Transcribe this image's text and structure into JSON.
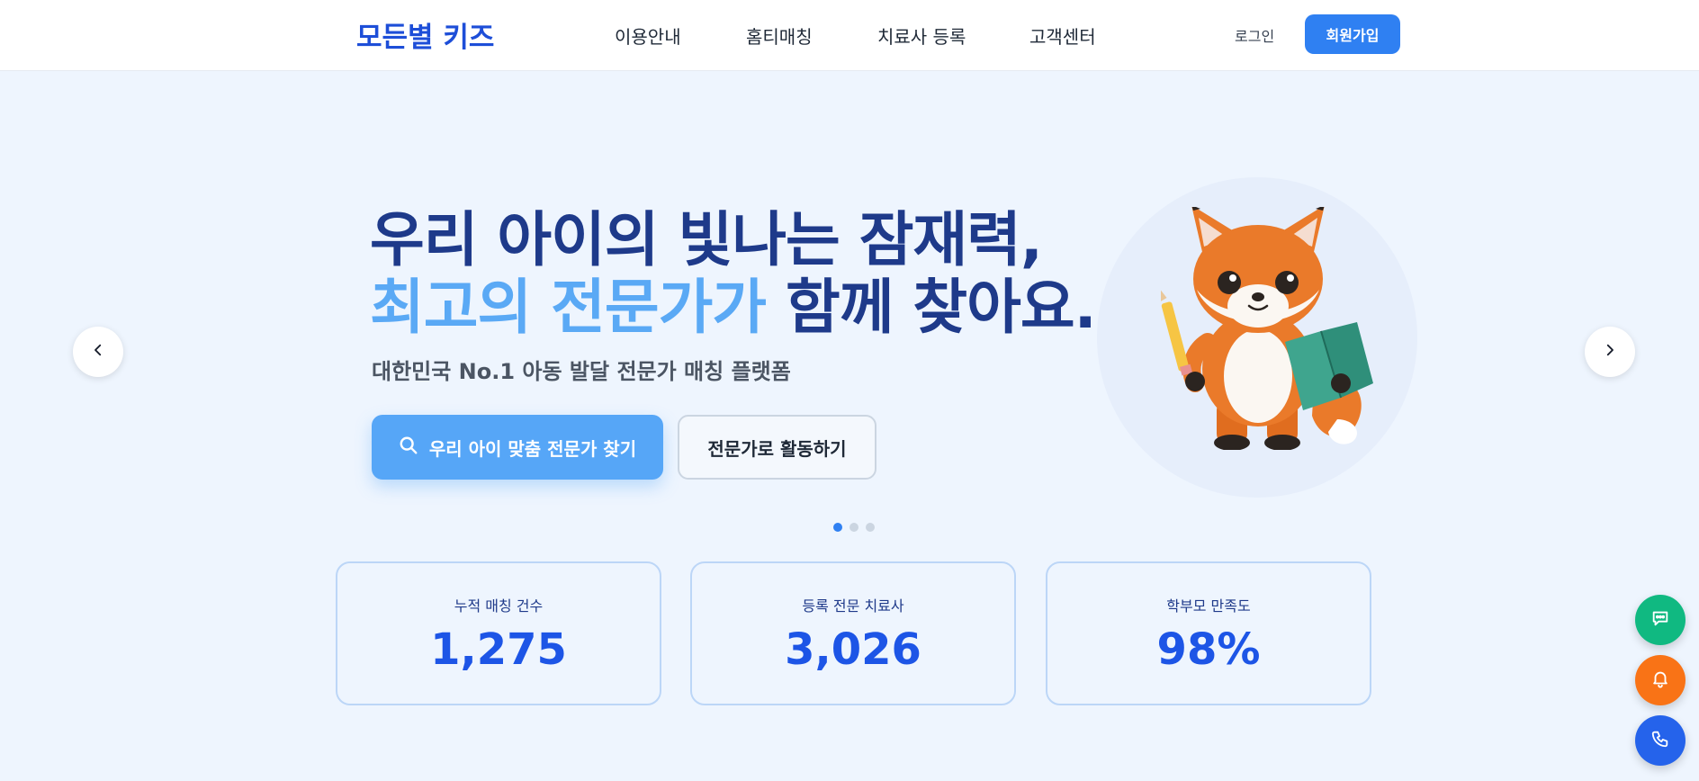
{
  "nav": {
    "logo": "모든별 키즈",
    "links": [
      "이용안내",
      "홈티매칭",
      "치료사 등록",
      "고객센터"
    ],
    "login": "로그인",
    "signup": "회원가입"
  },
  "hero": {
    "line1": "우리 아이의 빛나는 잠재력,",
    "line2_accent": "최고의 전문가가",
    "line2_rest": " 함께 찾아요.",
    "subtitle": "대한민국 No.1 아동 발달 전문가 매칭 플랫폼",
    "primary_button": "우리 아이 맞춤 전문가 찾기",
    "secondary_button": "전문가로 활동하기",
    "illustration": "fox-mascot-holding-pencil-and-book"
  },
  "carousel": {
    "slides": 3,
    "active_index": 0
  },
  "stats": [
    {
      "label": "누적 매칭 건수",
      "value": "1,275"
    },
    {
      "label": "등록 전문 치료사",
      "value": "3,026"
    },
    {
      "label": "학부모 만족도",
      "value": "98%"
    }
  ],
  "floating": [
    "chat-icon",
    "bell-icon",
    "phone-icon"
  ],
  "colors": {
    "brand": "#1d4ed8",
    "primary_button": "#56a6f7",
    "signup_button": "#2f80f2",
    "hero_bg": "#eef5fe",
    "chat": "#10b981",
    "bell": "#f97316",
    "phone": "#2563eb"
  }
}
